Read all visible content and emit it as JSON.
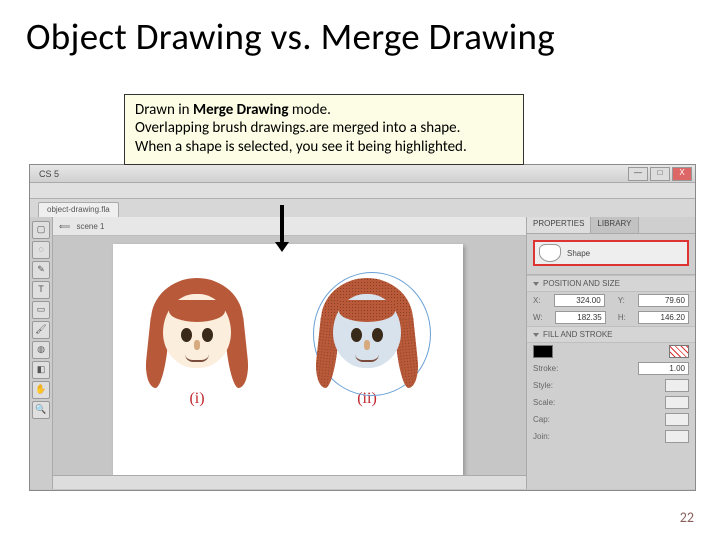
{
  "title": "Object Drawing vs. Merge Drawing",
  "page_number": "22",
  "callout": {
    "l1a": "Drawn in ",
    "l1b": "Merge Drawing ",
    "l1c": "mode.",
    "l2": "Overlapping brush drawings.are merged into a shape.",
    "l3": "When a shape is selected, you see it being highlighted."
  },
  "window": {
    "cs_tag": "CS 5",
    "min": "—",
    "max": "□",
    "close": "X"
  },
  "file_tab": "object-drawing.fla",
  "scene": {
    "arrow": "⟸",
    "label": "scene 1"
  },
  "captions": {
    "i": "(i)",
    "ii": "(ii)"
  },
  "panel": {
    "tab_props": "PROPERTIES",
    "tab_lib": "LIBRARY",
    "shape_label": "Shape",
    "sec_pos": "POSITION AND SIZE",
    "x_lab": "X:",
    "x_val": "324.00",
    "y_lab": "Y:",
    "y_val": "79.60",
    "w_lab": "W:",
    "w_val": "182.35",
    "h_lab": "H:",
    "h_val": "146.20",
    "sec_fill": "FILL AND STROKE",
    "stroke_lab": "Stroke:",
    "stroke_val": "1.00",
    "style_lab": "Style:",
    "scale_lab": "Scale:",
    "cap_lab": "Cap:",
    "join_lab": "Join:"
  }
}
